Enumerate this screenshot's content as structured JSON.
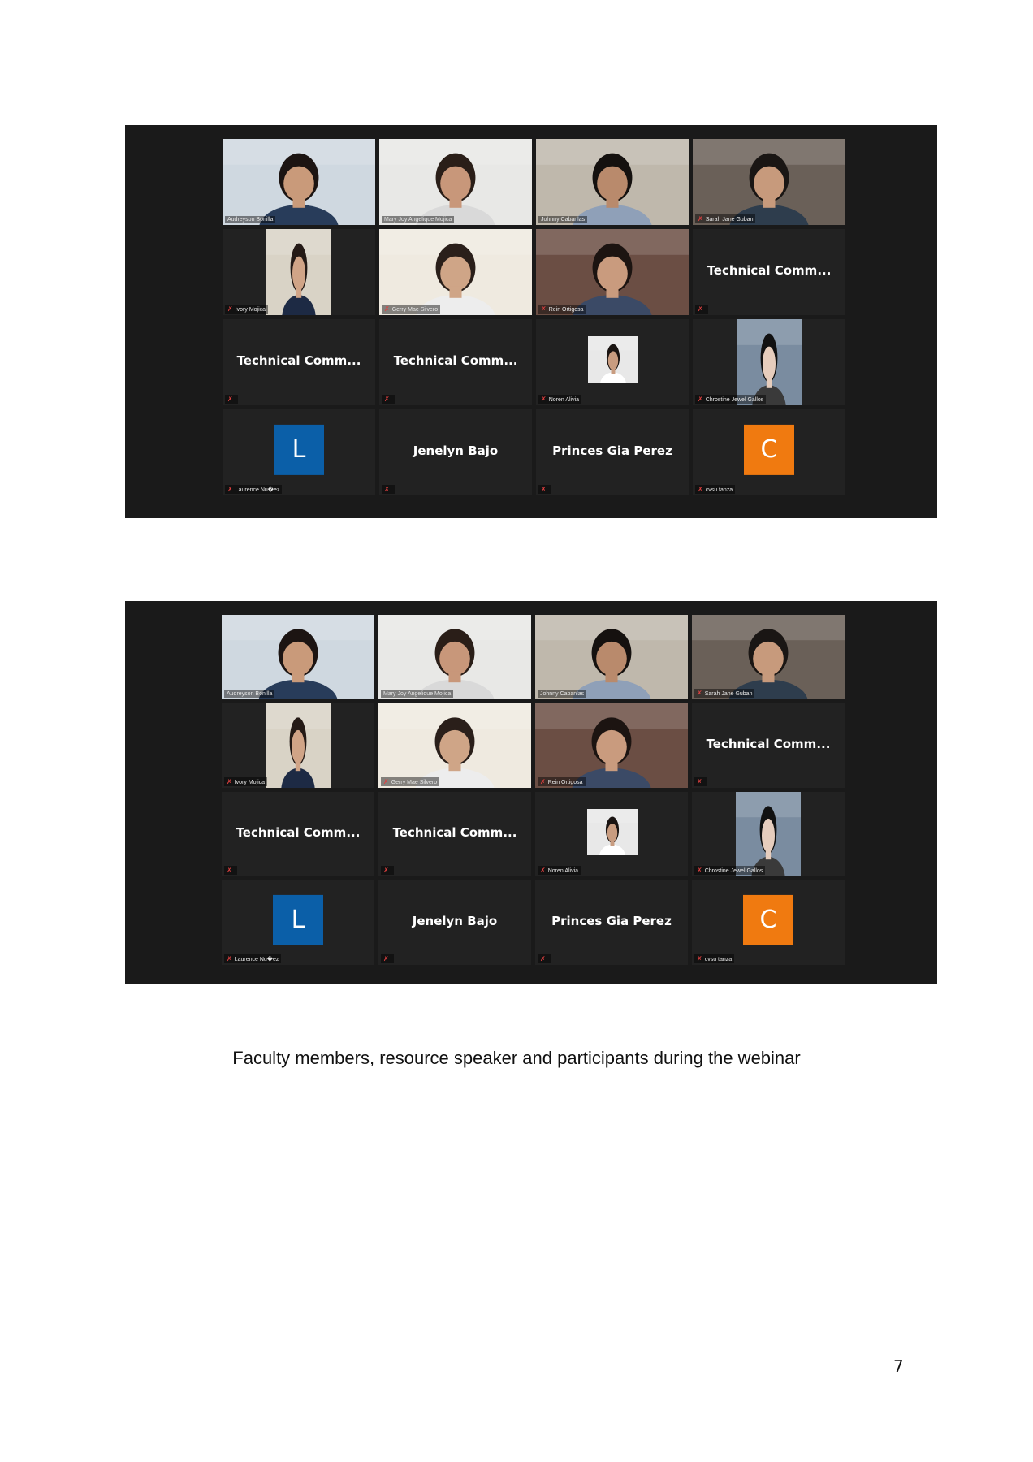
{
  "screenshots": [
    {
      "tiles": [
        {
          "type": "video",
          "label": "Audreyson Bonilla",
          "muted": false,
          "bg": "#cfd8e0",
          "skin": "#c99a7a",
          "hair": "#1c1412",
          "shirt": "#283c5a"
        },
        {
          "type": "video",
          "label": "Mary Joy Angelique Mojica",
          "muted": false,
          "active": true,
          "bg": "#e8e8e6",
          "skin": "#c8977a",
          "hair": "#2a1e18",
          "shirt": "#d9d9d9"
        },
        {
          "type": "video",
          "label": "Johnny Cabanlas",
          "muted": false,
          "bg": "#bfb8ac",
          "skin": "#b98a6c",
          "hair": "#15110f",
          "shirt": "#8fa0b8"
        },
        {
          "type": "video",
          "label": "Sarah Jane Guban",
          "muted": true,
          "bg": "#6a6058",
          "skin": "#c79a7c",
          "hair": "#1a1614",
          "shirt": "#2e3d4d"
        },
        {
          "type": "video-small",
          "label": "Ivory Mojica",
          "muted": true,
          "bg": "#d9d3c6",
          "skin": "#d0a487",
          "hair": "#241a16",
          "shirt": "#1d2a44"
        },
        {
          "type": "video",
          "label": "Gerry Mae Silvero",
          "muted": true,
          "bg": "#efeae0",
          "skin": "#cfa587",
          "hair": "#2a1f1a",
          "shirt": "#ededed"
        },
        {
          "type": "video",
          "label": "Rein Ortigosa",
          "muted": true,
          "bg": "#6b4e44",
          "skin": "#c99b7e",
          "hair": "#1c1411",
          "shirt": "#3b4a66"
        },
        {
          "type": "name",
          "name": "Technical  Comm...",
          "muted": true
        },
        {
          "type": "name",
          "name": "Technical  Comm...",
          "muted": true
        },
        {
          "type": "name",
          "name": "Technical  Comm...",
          "muted": true
        },
        {
          "type": "video-tiny",
          "label": "Noren Alivia",
          "muted": true,
          "bg": "#e8e8e8",
          "skin": "#c89c80",
          "hair": "#1a1412",
          "shirt": "#ffffff"
        },
        {
          "type": "video-small",
          "label": "Chrostine Jewel Gallos",
          "muted": true,
          "bg": "#7a8ca0",
          "skin": "#e6cdbd",
          "hair": "#111111",
          "shirt": "#3a3a3a"
        },
        {
          "type": "avatar",
          "letter": "L",
          "color": "#0b5fa8",
          "label": "Laurence Nu�ez",
          "muted": true
        },
        {
          "type": "name",
          "name": "Jenelyn Bajo",
          "muted": true
        },
        {
          "type": "name",
          "name": "Princes Gia Perez",
          "muted": true
        },
        {
          "type": "avatar",
          "letter": "C",
          "color": "#f07a10",
          "label": "cvsu tanza",
          "muted": true
        }
      ]
    },
    {
      "tiles": [
        {
          "type": "video",
          "label": "Audreyson Bonilla",
          "muted": false,
          "bg": "#cfd8e0",
          "skin": "#c99a7a",
          "hair": "#1c1412",
          "shirt": "#283c5a"
        },
        {
          "type": "video",
          "label": "Mary Joy Angelique Mojica",
          "muted": false,
          "active": true,
          "bg": "#e8e8e6",
          "skin": "#c8977a",
          "hair": "#2a1e18",
          "shirt": "#d9d9d9"
        },
        {
          "type": "video",
          "label": "Johnny Cabanlas",
          "muted": false,
          "bg": "#bfb8ac",
          "skin": "#b98a6c",
          "hair": "#15110f",
          "shirt": "#8fa0b8"
        },
        {
          "type": "video",
          "label": "Sarah Jane Guban",
          "muted": true,
          "bg": "#6a6058",
          "skin": "#c79a7c",
          "hair": "#1a1614",
          "shirt": "#2e3d4d"
        },
        {
          "type": "video-small",
          "label": "Ivory Mojica",
          "muted": true,
          "bg": "#d9d3c6",
          "skin": "#d0a487",
          "hair": "#241a16",
          "shirt": "#1d2a44"
        },
        {
          "type": "video",
          "label": "Gerry Mae Silvero",
          "muted": true,
          "bg": "#efeae0",
          "skin": "#cfa587",
          "hair": "#2a1f1a",
          "shirt": "#ededed"
        },
        {
          "type": "video",
          "label": "Rein Ortigosa",
          "muted": true,
          "bg": "#6b4e44",
          "skin": "#c99b7e",
          "hair": "#1c1411",
          "shirt": "#3b4a66"
        },
        {
          "type": "name",
          "name": "Technical  Comm...",
          "muted": true
        },
        {
          "type": "name",
          "name": "Technical  Comm...",
          "muted": true
        },
        {
          "type": "name",
          "name": "Technical  Comm...",
          "muted": true
        },
        {
          "type": "video-tiny",
          "label": "Noren Alivia",
          "muted": true,
          "bg": "#e8e8e8",
          "skin": "#c89c80",
          "hair": "#1a1412",
          "shirt": "#ffffff"
        },
        {
          "type": "video-small",
          "label": "Chrostine Jewel Gallos",
          "muted": true,
          "bg": "#7a8ca0",
          "skin": "#e6cdbd",
          "hair": "#111111",
          "shirt": "#3a3a3a"
        },
        {
          "type": "avatar",
          "letter": "L",
          "color": "#0b5fa8",
          "label": "Laurence Nu�ez",
          "muted": true
        },
        {
          "type": "name",
          "name": "Jenelyn Bajo",
          "muted": true
        },
        {
          "type": "name",
          "name": "Princes Gia Perez",
          "muted": true
        },
        {
          "type": "avatar",
          "letter": "C",
          "color": "#f07a10",
          "label": "cvsu tanza",
          "muted": true
        }
      ]
    }
  ],
  "caption": "Faculty members, resource speaker and participants during the webinar",
  "page_number": "7",
  "mute_icon": "muted-mic-icon"
}
